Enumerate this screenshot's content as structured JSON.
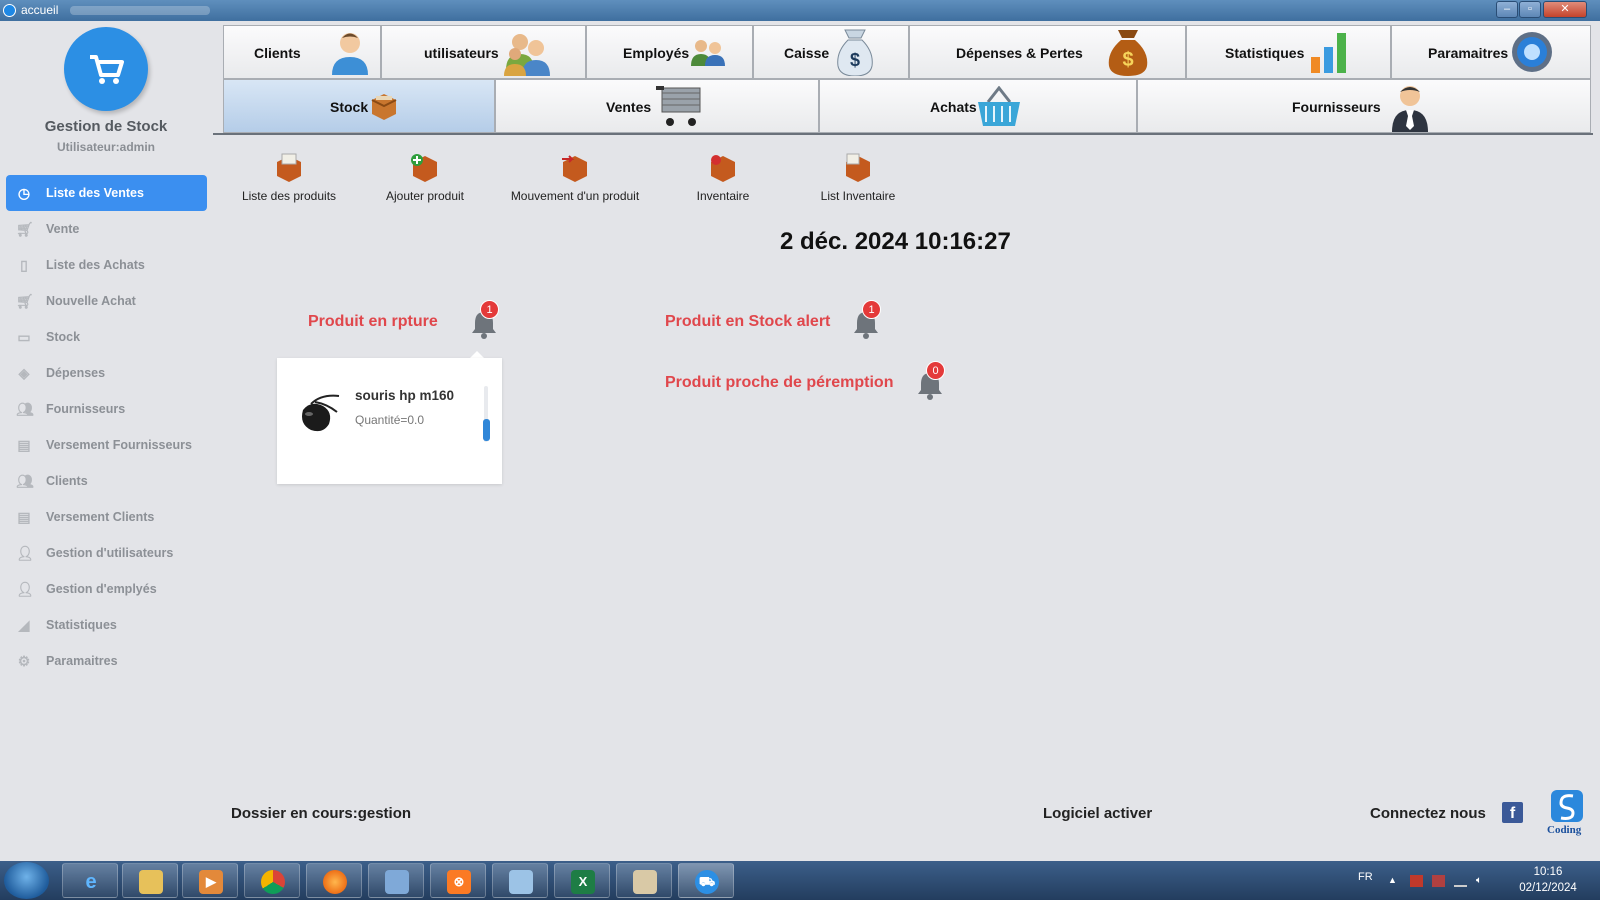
{
  "window": {
    "title": "accueil"
  },
  "sidebar": {
    "brand": "Gestion de Stock",
    "user": "Utilisateur:admin",
    "items": [
      {
        "label": "Liste des Ventes",
        "icon": "dashboard-icon"
      },
      {
        "label": "Vente",
        "icon": "cart-icon"
      },
      {
        "label": "Liste des Achats",
        "icon": "clipboard-icon"
      },
      {
        "label": "Nouvelle Achat",
        "icon": "cart-icon"
      },
      {
        "label": "Stock",
        "icon": "monitor-icon"
      },
      {
        "label": "Dépenses",
        "icon": "tag-icon"
      },
      {
        "label": "Fournisseurs",
        "icon": "users-icon"
      },
      {
        "label": "Versement Fournisseurs",
        "icon": "money-icon"
      },
      {
        "label": "Clients",
        "icon": "users-icon"
      },
      {
        "label": "Versement Clients",
        "icon": "money-icon"
      },
      {
        "label": "Gestion d'utilisateurs",
        "icon": "user-edit-icon"
      },
      {
        "label": "Gestion d'emplyés",
        "icon": "user-icon"
      },
      {
        "label": "Statistiques",
        "icon": "chart-icon"
      },
      {
        "label": "Paramaitres",
        "icon": "settings-icon"
      }
    ]
  },
  "tabs_row1": [
    {
      "label": "Clients"
    },
    {
      "label": "utilisateurs"
    },
    {
      "label": "Employés"
    },
    {
      "label": "Caisse"
    },
    {
      "label": "Dépenses & Pertes"
    },
    {
      "label": "Statistiques"
    },
    {
      "label": "Paramaitres"
    }
  ],
  "tabs_row2": [
    {
      "label": "Stock",
      "selected": true
    },
    {
      "label": "Ventes"
    },
    {
      "label": "Achats"
    },
    {
      "label": "Fournisseurs"
    }
  ],
  "stock_tools": [
    {
      "label": "Liste des produits"
    },
    {
      "label": "Ajouter produit"
    },
    {
      "label": "Mouvement d'un produit"
    },
    {
      "label": "Inventaire"
    },
    {
      "label": "List Inventaire"
    }
  ],
  "clock": "2 déc. 2024 10:16:27",
  "alerts": {
    "rupture": {
      "label": "Produit en rpture",
      "count": "1"
    },
    "stock_alert": {
      "label": "Produit en Stock alert",
      "count": "1"
    },
    "peremption": {
      "label": "Produit proche de péremption",
      "count": "0"
    }
  },
  "popup": {
    "product_name": "souris hp m160",
    "quantity": "Quantité=0.0"
  },
  "footer": {
    "dossier": "Dossier en cours:gestion",
    "license": "Logiciel activer",
    "connect": "Connectez nous",
    "facebook": "f",
    "brand": "Coding"
  },
  "taskbar": {
    "lang": "FR",
    "time": "10:16",
    "date": "02/12/2024"
  },
  "colors": {
    "accent": "#3b8ff0",
    "alert_red": "#e0474c",
    "badge": "#e43a3a"
  }
}
